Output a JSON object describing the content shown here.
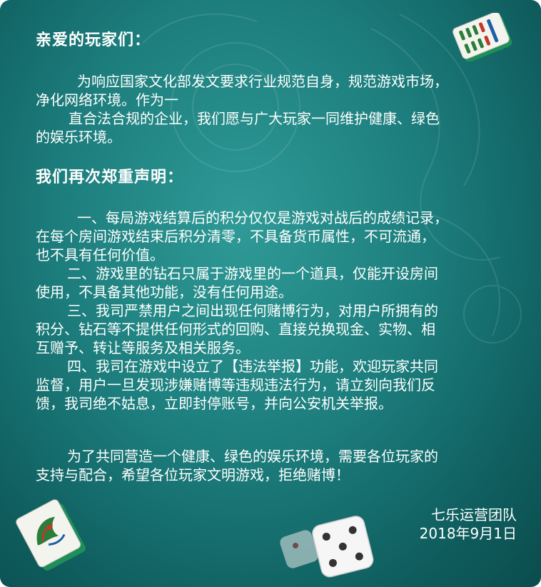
{
  "greeting": "亲爱的玩家们：",
  "intro": {
    "line1": "为响应国家文化部发文要求行业规范自身，规范游戏市场，",
    "line2": "净化网络环境。作为一",
    "line3": "直合法合规的企业，我们愿与广大玩家一同维护健康、绿色",
    "line4": "的娱乐环境。"
  },
  "declaration_heading": "我们再次郑重声明：",
  "points": {
    "p1_l1": "一、每局游戏结算后的积分仅仅是游戏对战后的成绩记录，",
    "p1_l2": "在每个房间游戏结束后积分清零，不具备货币属性，不可流通，",
    "p1_l3": "也不具有任何价值。",
    "p2_l1": "二、游戏里的钻石只属于游戏里的一个道具，仅能开设房间",
    "p2_l2": "使用，不具备其他功能，没有任何用途。",
    "p3_l1": "三、我司严禁用户之间出现任何赌博行为，对用户所拥有的",
    "p3_l2": "积分、钻石等不提供任何形式的回购、直接兑换现金、实物、相",
    "p3_l3": "互赠予、转让等服务及相关服务。",
    "p4_l1": "四、我司在游戏中设立了【违法举报】功能，欢迎玩家共同",
    "p4_l2": "监督，用户一旦发现涉嫌赌博等违规违法行为，请立刻向我们反",
    "p4_l3": "馈，我司绝不姑息，立即封停账号，并向公安机关举报。"
  },
  "closing": {
    "line1": "为了共同营造一个健康、绿色的娱乐环境，需要各位玩家的",
    "line2": "支持与配合，希望各位玩家文明游戏，拒绝赌博！"
  },
  "signature": {
    "team": "七乐运营团队",
    "date": "2018年9月1日"
  },
  "colors": {
    "background_center": "#2f9a97",
    "background_edge": "#0b4c4d",
    "text": "#ffffff",
    "tile_face": "#f4f4ee",
    "tile_back": "#1f8f5a"
  },
  "icons": [
    "mahjong-tile-eight-bamboo-icon",
    "mahjong-tile-bird-icon",
    "dice-icon"
  ]
}
